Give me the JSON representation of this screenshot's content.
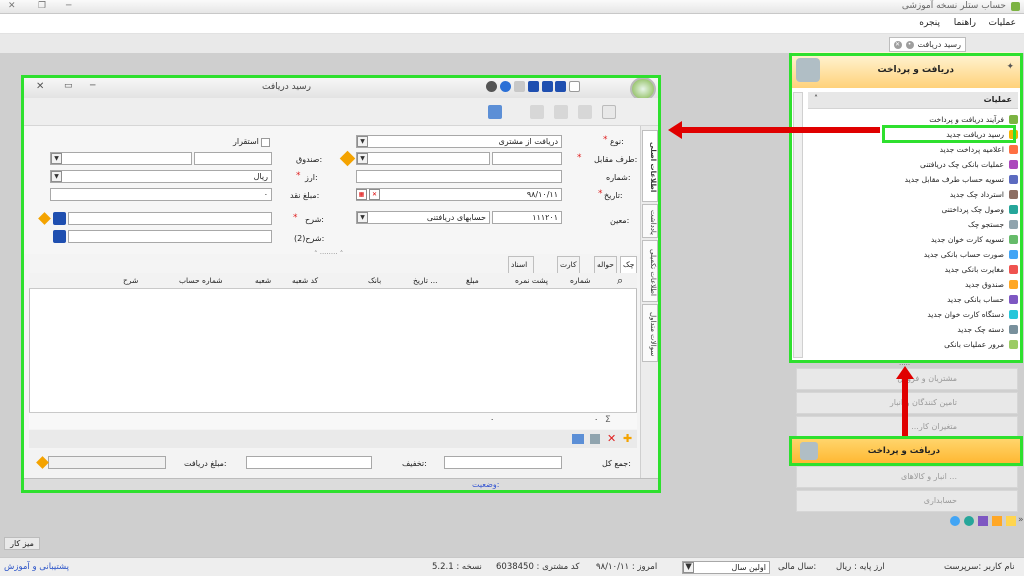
{
  "app": {
    "title": "حساب ستلر نسخه آموزشی"
  },
  "menu": {
    "items": [
      "عملیات",
      "راهنما",
      "پنجره"
    ]
  },
  "doc_tab": {
    "label": "رسید دریافت"
  },
  "window": {
    "title": "رسید دریافت"
  },
  "form": {
    "type_label": "نوع:",
    "type_value": "دریافت از مشتری",
    "party_label": "طرف مقابل:",
    "number_label": "شماره:",
    "date_label": "تاریخ:",
    "date_value": "۹۸/۱۰/۱۱",
    "moein_label": "معین:",
    "moein_code": "۱۱۱۲۰۱",
    "moein_value": "حسابهای دریافتنی",
    "estegrar_label": "استقرار",
    "cashbox_label": "صندوق:",
    "currency_label": "ارز:",
    "currency_value": "ریال",
    "cash_amount_label": "مبلغ نقد:",
    "cash_amount_value": "۰",
    "desc_label": "شرح:",
    "desc2_label": "شرح(2):"
  },
  "side_tabs": [
    "اطلاعات اصلی",
    "یادداشت",
    "اطلاعات تکمیلی",
    "سوالات متداول"
  ],
  "grid": {
    "tabs": [
      "چک",
      "حواله",
      "کارت خوان",
      "اسناد مرتبط"
    ],
    "columns": [
      "شماره",
      "پشت نمره",
      "مبلغ",
      "تاریخ ...",
      "بانک",
      "کد شعبه",
      "شعبه",
      "شماره حساب",
      "شرح"
    ],
    "footer_sigma": "Σ",
    "footer_values": [
      "۰",
      "۰"
    ]
  },
  "bottom": {
    "total_label": "جمع کل:",
    "discount_label": "تخفیف:",
    "received_label": "مبلغ دریافت:"
  },
  "window_status": {
    "label": "وضعیت:"
  },
  "right_panel": {
    "title": "دریافت و پرداخت",
    "section_title": "عملیات",
    "items": [
      "فرآیند دریافت و پرداخت",
      "رسید دریافت جدید",
      "اعلامیه پرداخت جدید",
      "عملیات بانکی چک دریافتنی",
      "تسویه حساب طرف مقابل جدید",
      "استرداد چک جدید",
      "وصول چک پرداختنی",
      "جستجو چک",
      "تسویه کارت خوان جدید",
      "صورت حساب بانکی جدید",
      "مغایرت بانکی جدید",
      "صندوق جدید",
      "حساب بانکی جدید",
      "دستگاه کارت خوان جدید",
      "دسته چک جدید",
      "مرور عملیات بانکی"
    ],
    "item_colors": [
      "#7cb342",
      "#f4b400",
      "#ff7043",
      "#ab47bc",
      "#5c6bc0",
      "#8d6e63",
      "#26a69a",
      "#90a4ae",
      "#66bb6a",
      "#42a5f5",
      "#ef5350",
      "#ffa726",
      "#7e57c2",
      "#26c6da",
      "#78909c",
      "#9ccc65"
    ]
  },
  "collapsed_panels": [
    "مشتریان و فروش",
    "تامین کنندگان و انبار",
    "...متغیران کار",
    "انبار و کالاهای ...",
    "حسابداری"
  ],
  "active_panel": {
    "label": "دریافت و پرداخت"
  },
  "desk": {
    "label": "میز کار"
  },
  "statusbar": {
    "user": "نام کاربر :سرپرست",
    "base_currency": "ارز پایه : ریال",
    "fiscal_year_label": "سال مالی:",
    "fiscal_year_value": "اولین سال",
    "today": "امروز :   ۹۸/۱۰/۱۱",
    "customer_code": "کد مشتری :   6038450",
    "version": "نسخه :   5.2.1",
    "support": "پشتیبانی و آموزش"
  },
  "colors": {
    "highlight_green": "#2ee02e",
    "arrow_red": "#e00000",
    "panel_orange": "#ffb730"
  }
}
